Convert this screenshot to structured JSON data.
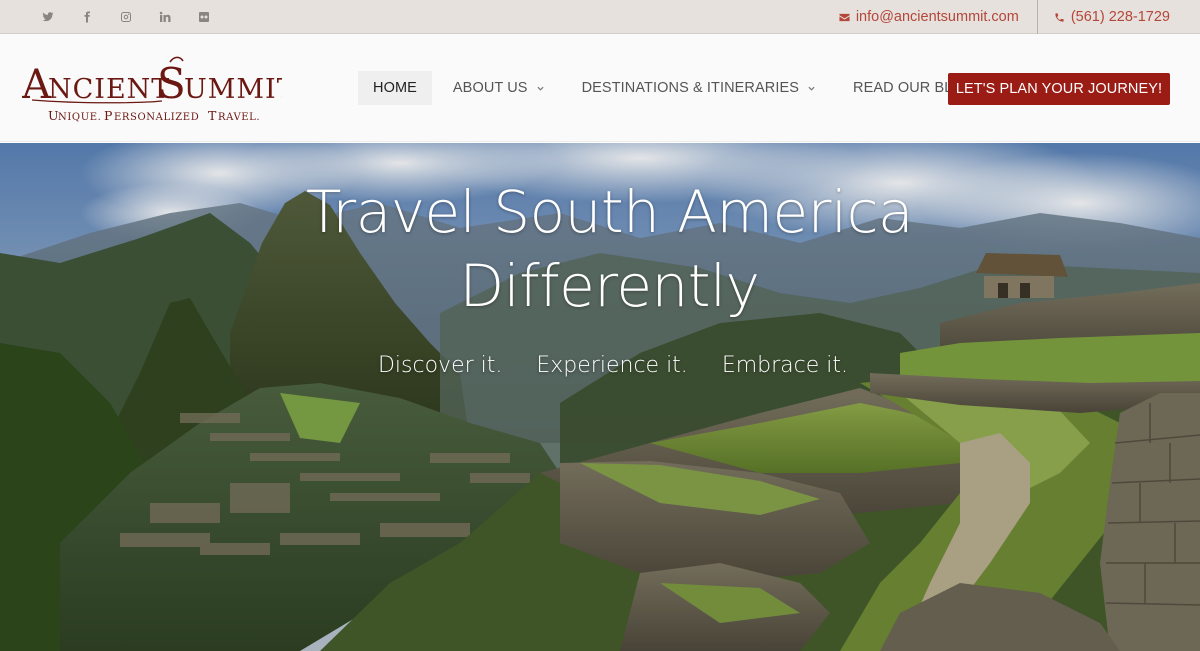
{
  "social": {
    "icons": [
      "twitter-icon",
      "facebook-icon",
      "instagram-icon",
      "linkedin-icon",
      "flickr-icon"
    ]
  },
  "contact": {
    "email": "info@ancientsummit.com",
    "phone": "(561) 228-1729"
  },
  "logo": {
    "name": "ANCIENT SUMMIT",
    "tagline": "UNIQUE. PERSONALIZED TRAVEL."
  },
  "nav": {
    "items": [
      {
        "label": "HOME",
        "active": true
      },
      {
        "label": "ABOUT US",
        "dropdown": true
      },
      {
        "label": "DESTINATIONS & ITINERARIES",
        "dropdown": true
      },
      {
        "label": "READ OUR BLOG"
      }
    ],
    "cta": "LET'S PLAN YOUR JOURNEY!"
  },
  "hero": {
    "title_line1": "Travel South America",
    "title_line2": "Differently",
    "taglines": [
      "Discover it.",
      "Experience it.",
      "Embrace it."
    ]
  },
  "colors": {
    "topbar": "#e6e1dc",
    "accent": "#b4463a",
    "cta": "#9b1c14",
    "logo": "#6b1712"
  }
}
